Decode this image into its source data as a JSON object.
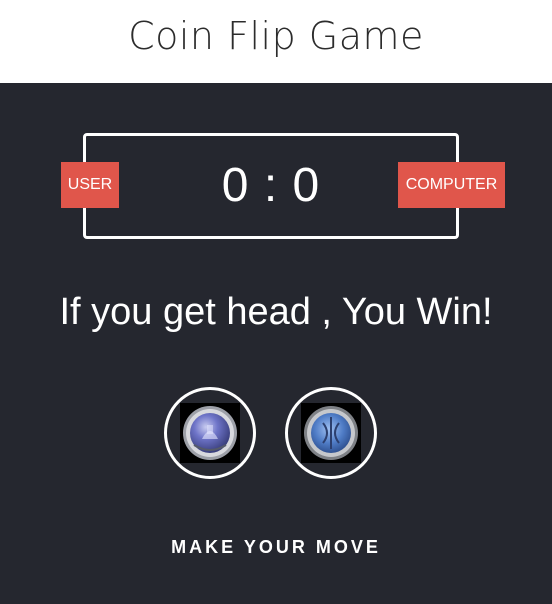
{
  "header": {
    "title": "Coin Flip Game"
  },
  "scoreboard": {
    "user_label": "USER",
    "computer_label": "COMPUTER",
    "score_display": "0 : 0",
    "user_score": 0,
    "computer_score": 0
  },
  "message": "If you get head , You Win!",
  "choices": {
    "heads_icon": "coin-heads-icon",
    "tails_icon": "coin-tails-icon"
  },
  "prompt": "MAKE YOUR MOVE",
  "colors": {
    "background_dark": "#25272f",
    "badge": "#e0564b",
    "header_bg": "#ffffff",
    "text_light": "#ffffff"
  }
}
